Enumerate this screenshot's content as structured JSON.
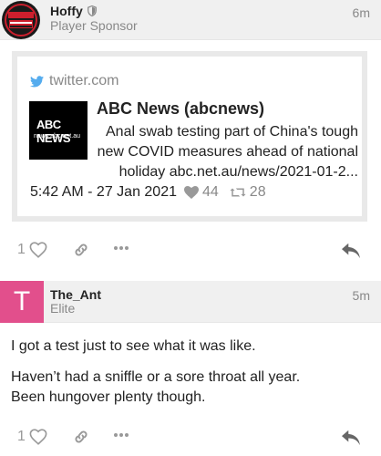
{
  "post1": {
    "username": "Hoffy",
    "user_title": "Player Sponsor",
    "age": "6m",
    "onebox": {
      "source": "twitter.com",
      "thumb_title": "ABC NEWS",
      "thumb_sub": "news.abc.net.au",
      "account": "ABC News (abcnews)",
      "text": "Anal swab testing part of China's tough new COVID measures ahead of national holiday abc.net.au/news/2021-01-2...",
      "timestamp": "5:42 AM - 27 Jan 2021",
      "likes": "44",
      "retweets": "28"
    },
    "like_count": "1"
  },
  "post2": {
    "avatar_letter": "T",
    "username": "The_Ant",
    "user_title": "Elite",
    "age": "5m",
    "paragraph1": "I got a test just to see what it was like.",
    "paragraph2_line1": "Haven’t had a sniffle or a sore throat all year.",
    "paragraph2_line2": "Been hungover plenty though.",
    "like_count": "1"
  },
  "colors": {
    "header_bg": "#f0f0f0",
    "avatar_t": "#e24f8c",
    "twitter_blue": "#55acee",
    "muted": "#888888"
  },
  "icons": [
    "shield-icon",
    "twitter-icon",
    "heart-icon",
    "retweet-icon",
    "link-icon",
    "more-icon",
    "reply-icon",
    "team-logo-icon"
  ]
}
